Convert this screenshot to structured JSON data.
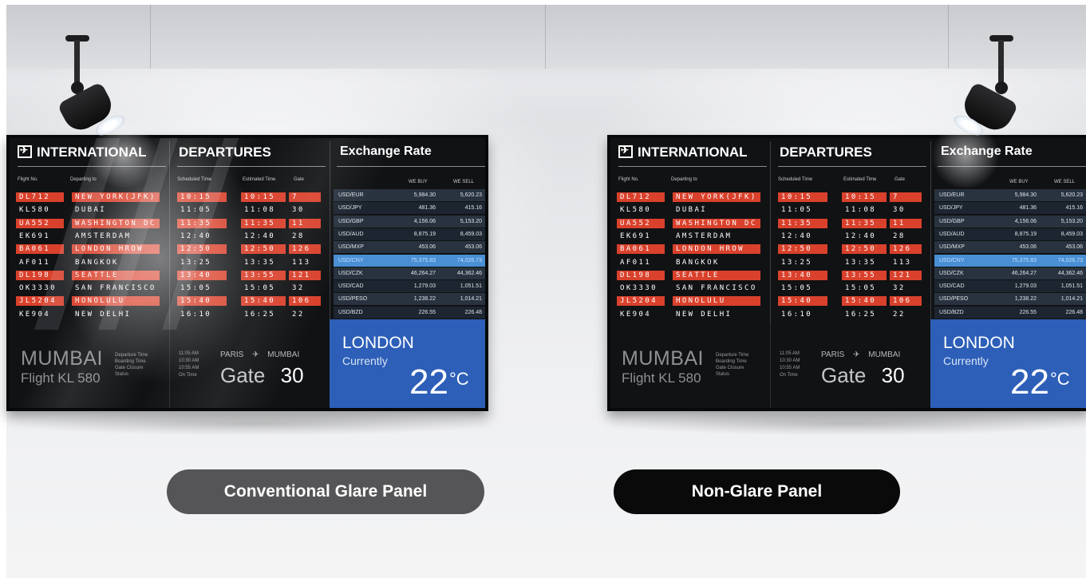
{
  "scene": {
    "left_label": "Conventional Glare Panel",
    "right_label": "Non-Glare Panel",
    "colors": {
      "left_pill": "#555557",
      "right_pill": "#0a0a0a",
      "flight_red": "#d9412c",
      "weather_blue": "#2d5fb8",
      "rate_highlight": "#4a8fd4"
    }
  },
  "display": {
    "title_intl": "INTERNATIONAL",
    "title_departures": "DEPARTURES",
    "title_exchange": "Exchange Rate",
    "col_flight": "Flight No.",
    "col_dest": "Departing to",
    "col_sched": "Scheduled Time",
    "col_est": "Estimated Time",
    "col_gate": "Gate",
    "col_buy": "WE BUY",
    "col_sell": "WE SELL",
    "flights": [
      {
        "no": "DL712",
        "to": "NEW YORK(JFK)",
        "sched": "10:15",
        "est": "10:15",
        "gate": "7",
        "red": true
      },
      {
        "no": "KL580",
        "to": "DUBAI",
        "sched": "11:05",
        "est": "11:08",
        "gate": "30",
        "red": false
      },
      {
        "no": "UA552",
        "to": "WASHINGTON DC",
        "sched": "11:35",
        "est": "11:35",
        "gate": "11",
        "red": true
      },
      {
        "no": "EK691",
        "to": "AMSTERDAM",
        "sched": "12:40",
        "est": "12:40",
        "gate": "28",
        "red": false
      },
      {
        "no": "BA061",
        "to": "LONDON HROW",
        "sched": "12:50",
        "est": "12:50",
        "gate": "126",
        "red": true
      },
      {
        "no": "AF011",
        "to": "BANGKOK",
        "sched": "13:25",
        "est": "13:35",
        "gate": "113",
        "red": false
      },
      {
        "no": "DL198",
        "to": "SEATTLE",
        "sched": "13:40",
        "est": "13:55",
        "gate": "121",
        "red": true
      },
      {
        "no": "OK3330",
        "to": "SAN FRANCISCO",
        "sched": "15:05",
        "est": "15:05",
        "gate": "32",
        "red": false
      },
      {
        "no": "JL5204",
        "to": "HONOLULU",
        "sched": "15:40",
        "est": "15:40",
        "gate": "106",
        "red": true
      },
      {
        "no": "KE904",
        "to": "NEW DELHI",
        "sched": "16:10",
        "est": "16:25",
        "gate": "22",
        "red": false
      }
    ],
    "rates": [
      {
        "pair": "USD/EUR",
        "buy": "5,984.30",
        "sell": "5,620.23"
      },
      {
        "pair": "USD/JPY",
        "buy": "481.36",
        "sell": "415.16"
      },
      {
        "pair": "USD/GBP",
        "buy": "4,156.06",
        "sell": "5,153.20"
      },
      {
        "pair": "USD/AUD",
        "buy": "8,875.19",
        "sell": "8,459.03"
      },
      {
        "pair": "USD/MXP",
        "buy": "453.06",
        "sell": "453.06"
      },
      {
        "pair": "USD/CNY",
        "buy": "75,375.83",
        "sell": "74,026.73"
      },
      {
        "pair": "USD/CZK",
        "buy": "46,264.27",
        "sell": "44,362.46"
      },
      {
        "pair": "USD/CAD",
        "buy": "1,279.03",
        "sell": "1,051.51"
      },
      {
        "pair": "USD/PESO",
        "buy": "1,238.22",
        "sell": "1,014.21"
      },
      {
        "pair": "USD/BZD",
        "buy": "226.55",
        "sell": "226.48"
      }
    ],
    "city": "MUMBAI",
    "flight": "Flight KL 580",
    "info_lines": [
      "Departure Time",
      "Boarding Time",
      "Gate Closure",
      "Status"
    ],
    "times": [
      "11:05 AM",
      "10:30 AM",
      "10:55 AM",
      "On Time"
    ],
    "route_from": "PARIS",
    "route_to": "MUMBAI",
    "gate_label": "Gate",
    "gate_no": "30",
    "weather_city": "LONDON",
    "weather_sub": "Currently",
    "temp": "22",
    "temp_unit": "°C"
  }
}
